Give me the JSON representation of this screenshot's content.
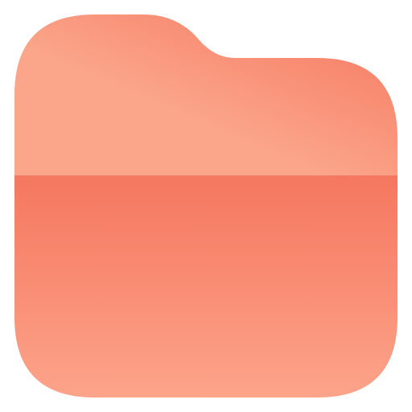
{
  "icon": {
    "name": "folder-icon",
    "colors": {
      "back_light": "#FBA68B",
      "back_dark": "#F5775F",
      "front_top": "#F5775F",
      "front_bottom": "#FCA48A"
    }
  }
}
